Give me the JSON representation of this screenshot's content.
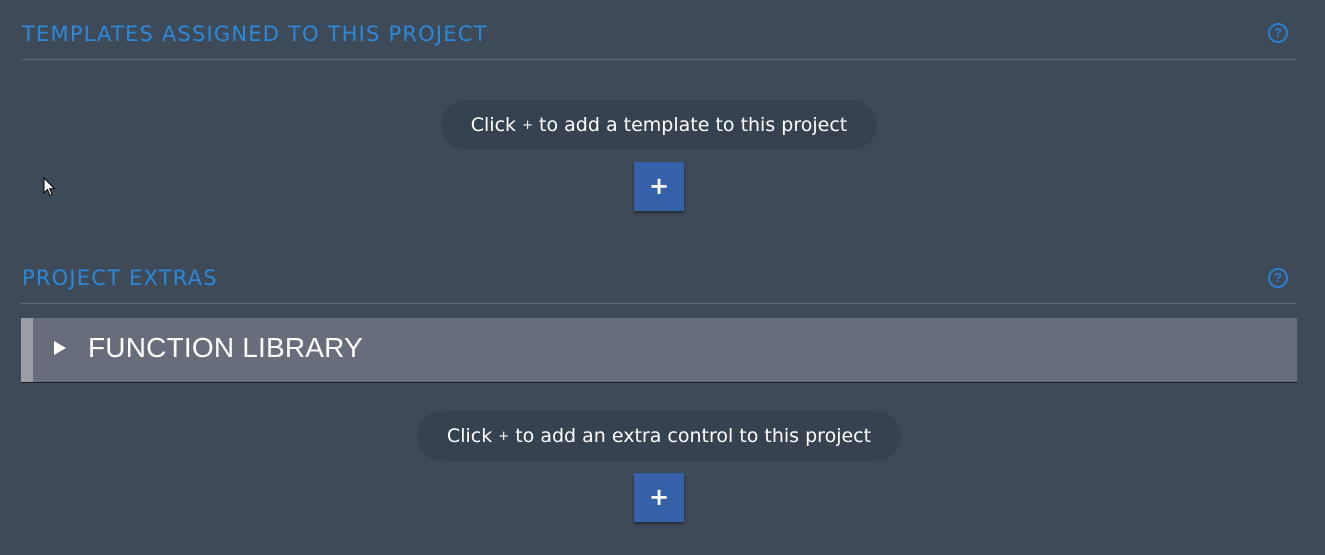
{
  "templates_section": {
    "title": "TEMPLATES ASSIGNED TO THIS PROJECT",
    "help": "?",
    "hint_before": "Click",
    "hint_plus": "+",
    "hint_after": "to add a template to this project",
    "add_button": "+"
  },
  "extras_section": {
    "title": "PROJECT EXTRAS",
    "help": "?",
    "accordion_label": "FUNCTION LIBRARY",
    "hint_before": "Click",
    "hint_plus": "+",
    "hint_after": "to add an extra control to this project",
    "add_button": "+"
  },
  "icons": {
    "help": "question-circle-icon",
    "expand": "triangle-right-icon",
    "cursor": "mouse-pointer-icon"
  },
  "colors": {
    "background": "#3f4a59",
    "accent": "#2b88d9",
    "button": "#3561a8",
    "accordion": "#676d7b"
  }
}
